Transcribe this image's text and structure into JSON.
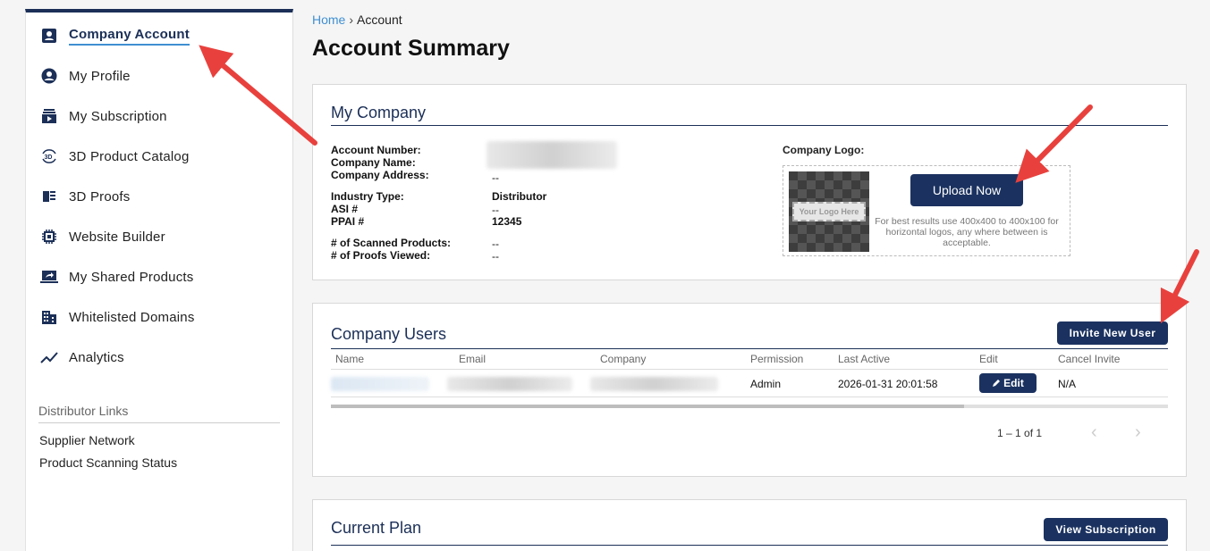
{
  "sidebar": {
    "items": [
      {
        "label": "Company Account",
        "icon": "account-box-icon"
      },
      {
        "label": "My Profile",
        "icon": "user-circle-icon"
      },
      {
        "label": "My Subscription",
        "icon": "subscription-icon"
      },
      {
        "label": "3D Product Catalog",
        "icon": "rotate-3d-icon"
      },
      {
        "label": "3D Proofs",
        "icon": "proofs-icon"
      },
      {
        "label": "Website Builder",
        "icon": "chip-icon"
      },
      {
        "label": "My Shared Products",
        "icon": "share-screen-icon"
      },
      {
        "label": "Whitelisted Domains",
        "icon": "building-icon"
      },
      {
        "label": "Analytics",
        "icon": "trending-icon"
      }
    ],
    "section_title": "Distributor Links",
    "links": [
      "Supplier Network",
      "Product Scanning Status"
    ]
  },
  "breadcrumb": {
    "home": "Home",
    "separator": "›",
    "current": "Account"
  },
  "page_title": "Account Summary",
  "my_company": {
    "title": "My Company",
    "account_number_label": "Account Number:",
    "company_name_label": "Company Name:",
    "company_address_label": "Company Address:",
    "company_address_value": "--",
    "industry_type_label": "Industry Type:",
    "industry_type_value": "Distributor",
    "asi_label": "ASI #",
    "asi_value": "--",
    "ppai_label": "PPAI #",
    "ppai_value": "12345",
    "scanned_label": "# of Scanned Products:",
    "scanned_value": "--",
    "proofs_label": "# of Proofs Viewed:",
    "proofs_value": "--",
    "logo_label": "Company Logo:",
    "logo_placeholder": "Your Logo Here",
    "upload_button": "Upload Now",
    "upload_hint": "For best results use 400x400 to 400x100 for horizontal logos, any where between is acceptable."
  },
  "company_users": {
    "title": "Company Users",
    "invite_button": "Invite New User",
    "columns": [
      "Name",
      "Email",
      "Company",
      "Permission",
      "Last Active",
      "Edit",
      "Cancel Invite"
    ],
    "rows": [
      {
        "permission": "Admin",
        "last_active": "2026-01-31 20:01:58",
        "edit": "Edit",
        "cancel_invite": "N/A"
      }
    ],
    "pagination": "1 – 1 of 1",
    "prev": "‹",
    "next": "›"
  },
  "current_plan": {
    "title": "Current Plan",
    "view_button": "View Subscription"
  },
  "colors": {
    "accent": "#1b3260",
    "link": "#3f8fd2",
    "annotation_arrow": "#e8413d"
  }
}
